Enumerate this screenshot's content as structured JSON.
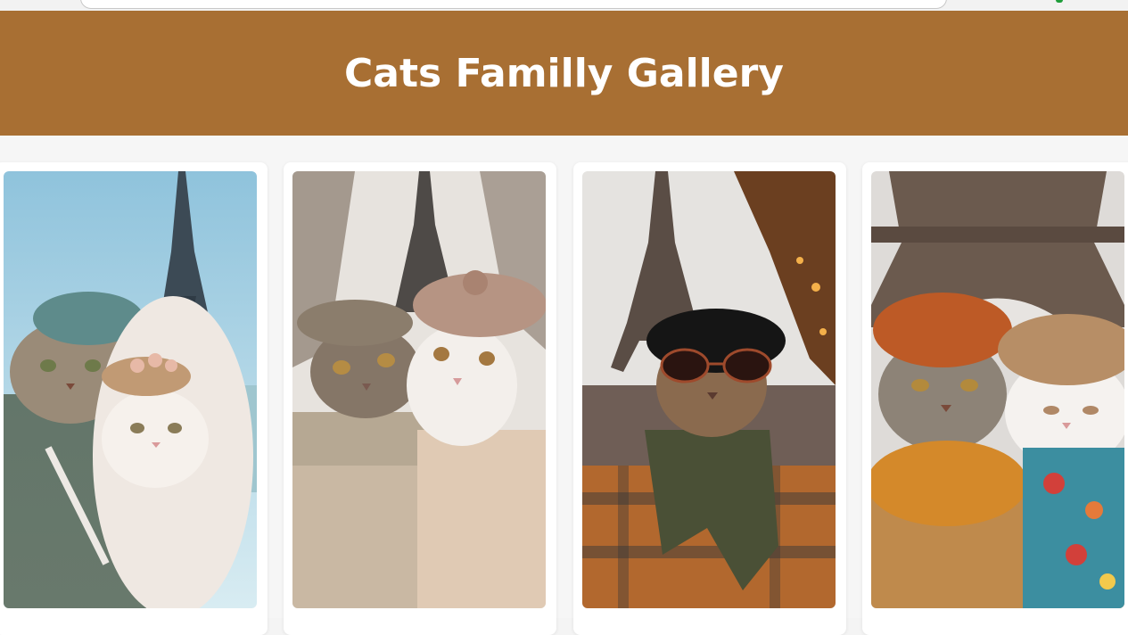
{
  "header": {
    "title": "Cats Familly Gallery",
    "background": "#a86f33"
  },
  "gallery": {
    "items": [
      {
        "name": "gallery-photo-1",
        "description_icon": "cats-eiffel-photo"
      },
      {
        "name": "gallery-photo-2",
        "description_icon": "cats-eiffel-photo"
      },
      {
        "name": "gallery-photo-3",
        "description_icon": "cat-eiffel-photo"
      },
      {
        "name": "gallery-photo-4",
        "description_icon": "cats-eiffel-photo"
      }
    ]
  }
}
